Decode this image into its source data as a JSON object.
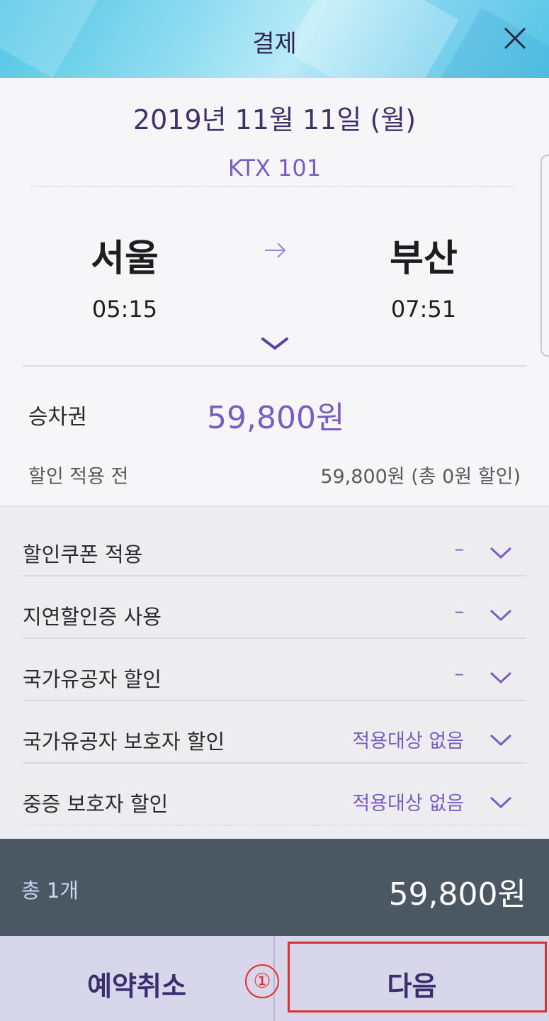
{
  "header": {
    "title": "결제"
  },
  "trip": {
    "date": "2019년 11월 11일 (월)",
    "train": "KTX 101",
    "departure": {
      "station": "서울",
      "time": "05:15"
    },
    "arrival": {
      "station": "부산",
      "time": "07:51"
    }
  },
  "fare": {
    "ticket_label": "승차권",
    "ticket_price": "59,800원",
    "before_label": "할인 적용 전",
    "before_value": "59,800원 (총 0원 할인)"
  },
  "discounts": [
    {
      "label": "할인쿠폰 적용",
      "status": "–"
    },
    {
      "label": "지연할인증 사용",
      "status": "–"
    },
    {
      "label": "국가유공자 할인",
      "status": "–"
    },
    {
      "label": "국가유공자 보호자 할인",
      "status": "적용대상 없음"
    },
    {
      "label": "중증 보호자 할인",
      "status": "적용대상 없음"
    }
  ],
  "total": {
    "count": "총 1개",
    "price": "59,800원"
  },
  "buttons": {
    "cancel": "예약취소",
    "next": "다음"
  },
  "annotation": {
    "step_marker": "①"
  },
  "colors": {
    "accent": "#7b5bc4",
    "header_start": "#4fc6e6",
    "total_bar": "#4b5763",
    "button_bar": "#d7d6ea",
    "highlight": "#e0302c"
  },
  "icons": {
    "close": "close-icon",
    "arrow": "arrow-right-icon",
    "expand": "chevron-down-icon"
  }
}
